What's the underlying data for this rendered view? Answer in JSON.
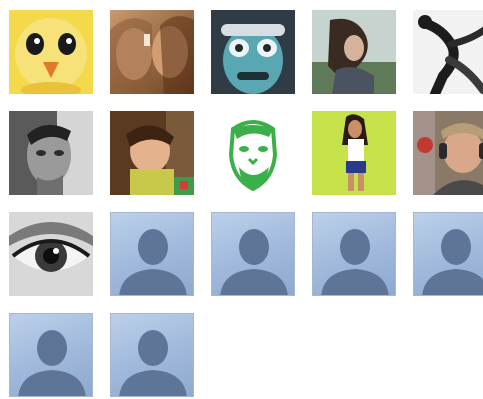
{
  "friends_grid": {
    "columns": 5,
    "tiles": [
      {
        "kind": "photo",
        "icon": "cartoon-chick-photo-icon",
        "bg": "#f4d94a"
      },
      {
        "kind": "photo",
        "icon": "two-women-photo-icon",
        "bg": "#a8704a"
      },
      {
        "kind": "photo",
        "icon": "inverted-face-goggles-photo-icon",
        "bg": "#3a4a56"
      },
      {
        "kind": "photo",
        "icon": "woman-outdoors-photo-icon",
        "bg": "#7f9884"
      },
      {
        "kind": "photo",
        "icon": "dancer-bw-photo-icon",
        "bg": "#eeeeee"
      },
      {
        "kind": "photo",
        "icon": "man-portrait-bw-photo-icon",
        "bg": "#8a8a8a"
      },
      {
        "kind": "photo",
        "icon": "child-selfie-photo-icon",
        "bg": "#6b4b2a"
      },
      {
        "kind": "photo",
        "icon": "green-line-art-face-icon",
        "bg": "#ffffff"
      },
      {
        "kind": "photo",
        "icon": "girl-on-green-photo-icon",
        "bg": "#c6e04a"
      },
      {
        "kind": "photo",
        "icon": "man-headphones-photo-icon",
        "bg": "#7c6a58"
      },
      {
        "kind": "photo",
        "icon": "eye-closeup-photo-icon",
        "bg": "#dcdcdc"
      },
      {
        "kind": "default",
        "icon": "default-avatar-icon"
      },
      {
        "kind": "default",
        "icon": "default-avatar-icon"
      },
      {
        "kind": "default",
        "icon": "default-avatar-icon"
      },
      {
        "kind": "default",
        "icon": "default-avatar-icon"
      },
      {
        "kind": "default",
        "icon": "default-avatar-icon"
      },
      {
        "kind": "default",
        "icon": "default-avatar-icon"
      }
    ]
  },
  "colors": {
    "avatar_silhouette": "#5f7597",
    "avatar_bg_light": "#bcd0ea",
    "avatar_bg_dark": "#8ea9d0"
  }
}
